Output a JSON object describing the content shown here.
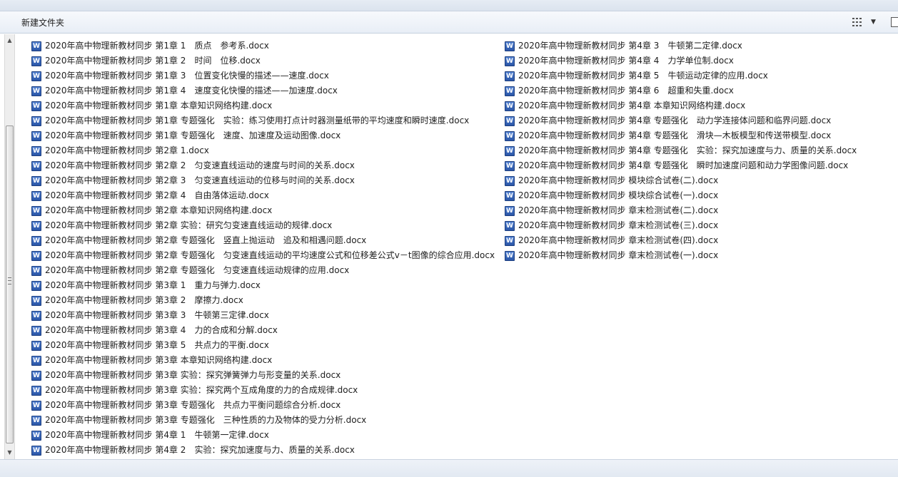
{
  "toolbar": {
    "new_folder_label": "新建文件夹",
    "view_icon": "details-view-icon",
    "view_arrow": "▼",
    "view_arrow_icon": "chevron-down-icon",
    "preview_icon": "preview-pane-icon"
  },
  "scrollbar": {
    "up_arrow": "▲",
    "down_arrow": "▼"
  },
  "files": {
    "icon": "word-docx-icon",
    "icon_letter": "W",
    "left": [
      "2020年高中物理新教材同步 第1章 1　质点　参考系.docx",
      "2020年高中物理新教材同步 第1章 2　时间　位移.docx",
      "2020年高中物理新教材同步 第1章 3　位置变化快慢的描述——速度.docx",
      "2020年高中物理新教材同步 第1章 4　速度变化快慢的描述——加速度.docx",
      "2020年高中物理新教材同步 第1章 本章知识网络构建.docx",
      "2020年高中物理新教材同步 第1章 专题强化　实验：练习使用打点计时器测量纸带的平均速度和瞬时速度.docx",
      "2020年高中物理新教材同步 第1章 专题强化　速度、加速度及运动图像.docx",
      "2020年高中物理新教材同步 第2章 1.docx",
      "2020年高中物理新教材同步 第2章 2　匀变速直线运动的速度与时间的关系.docx",
      "2020年高中物理新教材同步 第2章 3　匀变速直线运动的位移与时间的关系.docx",
      "2020年高中物理新教材同步 第2章 4　自由落体运动.docx",
      "2020年高中物理新教材同步 第2章 本章知识网络构建.docx",
      "2020年高中物理新教材同步 第2章 实验：研究匀变速直线运动的规律.docx",
      "2020年高中物理新教材同步 第2章 专题强化　竖直上抛运动　追及和相遇问题.docx",
      "2020年高中物理新教材同步 第2章 专题强化　匀变速直线运动的平均速度公式和位移差公式v－t图像的综合应用.docx",
      "2020年高中物理新教材同步 第2章 专题强化　匀变速直线运动规律的应用.docx",
      "2020年高中物理新教材同步 第3章 1　重力与弹力.docx",
      "2020年高中物理新教材同步 第3章 2　摩擦力.docx",
      "2020年高中物理新教材同步 第3章 3　牛顿第三定律.docx",
      "2020年高中物理新教材同步 第3章 4　力的合成和分解.docx",
      "2020年高中物理新教材同步 第3章 5　共点力的平衡.docx",
      "2020年高中物理新教材同步 第3章 本章知识网络构建.docx",
      "2020年高中物理新教材同步 第3章 实验：探究弹簧弹力与形变量的关系.docx",
      "2020年高中物理新教材同步 第3章 实验：探究两个互成角度的力的合成规律.docx",
      "2020年高中物理新教材同步 第3章 专题强化　共点力平衡问题综合分析.docx",
      "2020年高中物理新教材同步 第3章 专题强化　三种性质的力及物体的受力分析.docx",
      "2020年高中物理新教材同步 第4章 1　牛顿第一定律.docx",
      "2020年高中物理新教材同步 第4章 2　实验：探究加速度与力、质量的关系.docx"
    ],
    "right": [
      "2020年高中物理新教材同步 第4章 3　牛顿第二定律.docx",
      "2020年高中物理新教材同步 第4章 4　力学单位制.docx",
      "2020年高中物理新教材同步 第4章 5　牛顿运动定律的应用.docx",
      "2020年高中物理新教材同步 第4章 6　超重和失重.docx",
      "2020年高中物理新教材同步 第4章 本章知识网络构建.docx",
      "2020年高中物理新教材同步 第4章 专题强化　动力学连接体问题和临界问题.docx",
      "2020年高中物理新教材同步 第4章 专题强化　滑块—木板模型和传送带模型.docx",
      "2020年高中物理新教材同步 第4章 专题强化　实验：探究加速度与力、质量的关系.docx",
      "2020年高中物理新教材同步 第4章 专题强化　瞬时加速度问题和动力学图像问题.docx",
      "2020年高中物理新教材同步 模块综合试卷(二).docx",
      "2020年高中物理新教材同步 模块综合试卷(一).docx",
      "2020年高中物理新教材同步 章末检测试卷(二).docx",
      "2020年高中物理新教材同步 章末检测试卷(三).docx",
      "2020年高中物理新教材同步 章末检测试卷(四).docx",
      "2020年高中物理新教材同步 章末检测试卷(一).docx"
    ]
  }
}
